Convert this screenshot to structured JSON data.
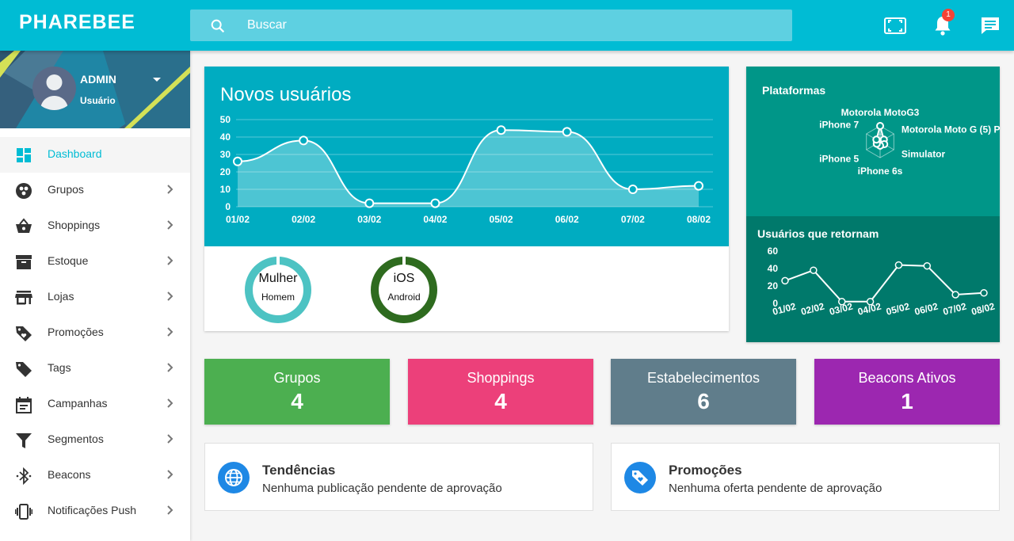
{
  "app": {
    "logo": "PHAREBEE"
  },
  "search": {
    "placeholder": "Buscar"
  },
  "header": {
    "notification_count": "1"
  },
  "user": {
    "name": "ADMIN",
    "role": "Usuário"
  },
  "sidebar": {
    "items": [
      {
        "label": "Dashboard",
        "icon": "dashboard-icon",
        "active": true
      },
      {
        "label": "Grupos",
        "icon": "groups-icon"
      },
      {
        "label": "Shoppings",
        "icon": "basket-icon"
      },
      {
        "label": "Estoque",
        "icon": "archive-icon"
      },
      {
        "label": "Lojas",
        "icon": "store-icon"
      },
      {
        "label": "Promoções",
        "icon": "tag-icon"
      },
      {
        "label": "Tags",
        "icon": "label-icon"
      },
      {
        "label": "Campanhas",
        "icon": "calendar-icon"
      },
      {
        "label": "Segmentos",
        "icon": "filter-icon"
      },
      {
        "label": "Beacons",
        "icon": "bluetooth-icon"
      },
      {
        "label": "Notificações Push",
        "icon": "vibration-icon"
      }
    ]
  },
  "novos_usuarios": {
    "title": "Novos usuários"
  },
  "plataformas": {
    "title": "Plataformas"
  },
  "retornam": {
    "title": "Usuários que retornam"
  },
  "donuts": [
    {
      "top": "Mulher",
      "bottom": "Homem",
      "color": "#4dc3c3"
    },
    {
      "top": "iOS",
      "bottom": "Android",
      "color": "#2e6b1f"
    }
  ],
  "stats": [
    {
      "label": "Grupos",
      "value": "4",
      "color": "#4caf50"
    },
    {
      "label": "Shoppings",
      "value": "4",
      "color": "#ec407a"
    },
    {
      "label": "Estabelecimentos",
      "value": "6",
      "color": "#607d8b"
    },
    {
      "label": "Beacons Ativos",
      "value": "1",
      "color": "#9c27b0"
    }
  ],
  "info": [
    {
      "title": "Tendências",
      "subtitle": "Nenhuma publicação pendente de aprovação",
      "icon": "globe-icon"
    },
    {
      "title": "Promoções",
      "subtitle": "Nenhuma oferta pendente de aprovação",
      "icon": "tag-icon"
    }
  ],
  "chart_data": [
    {
      "type": "area",
      "title": "Novos usuários",
      "categories": [
        "01/02",
        "02/02",
        "03/02",
        "04/02",
        "05/02",
        "06/02",
        "07/02",
        "08/02"
      ],
      "values": [
        26,
        38,
        2,
        2,
        44,
        43,
        10,
        12
      ],
      "yticks": [
        0,
        10,
        20,
        30,
        40,
        50
      ],
      "ylim": [
        0,
        50
      ],
      "grid": true
    },
    {
      "type": "radar",
      "title": "Plataformas",
      "categories": [
        "Motorola MotoG3",
        "Motorola Moto G (5) P",
        "Simulator",
        "iPhone 6s",
        "iPhone 5",
        "iPhone 7"
      ],
      "values": [
        3.3,
        0.9,
        1.0,
        0.8,
        0.8,
        0.9
      ]
    },
    {
      "type": "line",
      "title": "Usuários que retornam",
      "categories": [
        "01/02",
        "02/02",
        "03/02",
        "04/02",
        "05/02",
        "06/02",
        "07/02",
        "08/02"
      ],
      "values": [
        26,
        38,
        2,
        2,
        44,
        43,
        10,
        12
      ],
      "yticks": [
        0,
        20,
        40,
        60
      ],
      "ylim": [
        0,
        60
      ]
    }
  ]
}
